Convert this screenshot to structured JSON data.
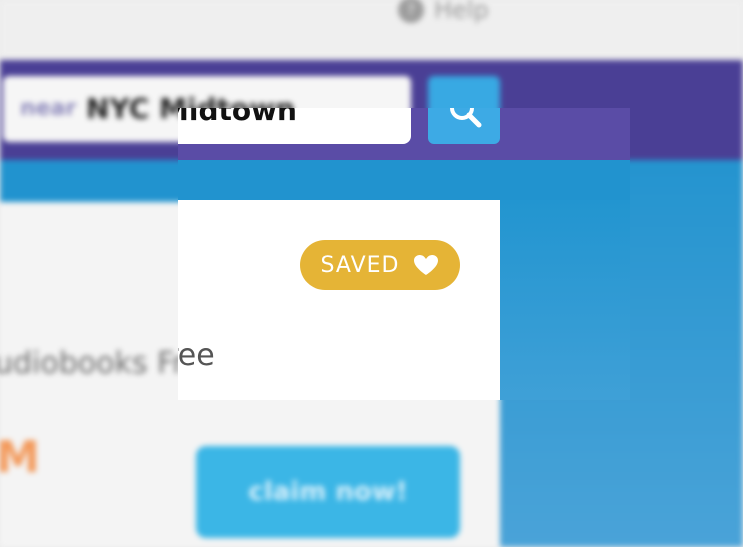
{
  "background": {
    "help_label": "Help",
    "help_icon": "question-circle-icon",
    "search_prefix": "near",
    "search_value": "NYC Midtown",
    "headline_fragment": "udiobooks Free",
    "promo_fragment": "M",
    "claim_label": "claim now!"
  },
  "modal": {
    "search_value": "NYC Midtown",
    "search_icon": "magnifier-icon",
    "saved_label": "SAVED",
    "saved_icon": "heart-icon",
    "headline_fragment": "udiobooks Free"
  },
  "colors": {
    "nav_band": "#5a4ca6",
    "strip": "#2193cf",
    "search_button": "#3daae5",
    "saved_button": "#e5b436"
  }
}
